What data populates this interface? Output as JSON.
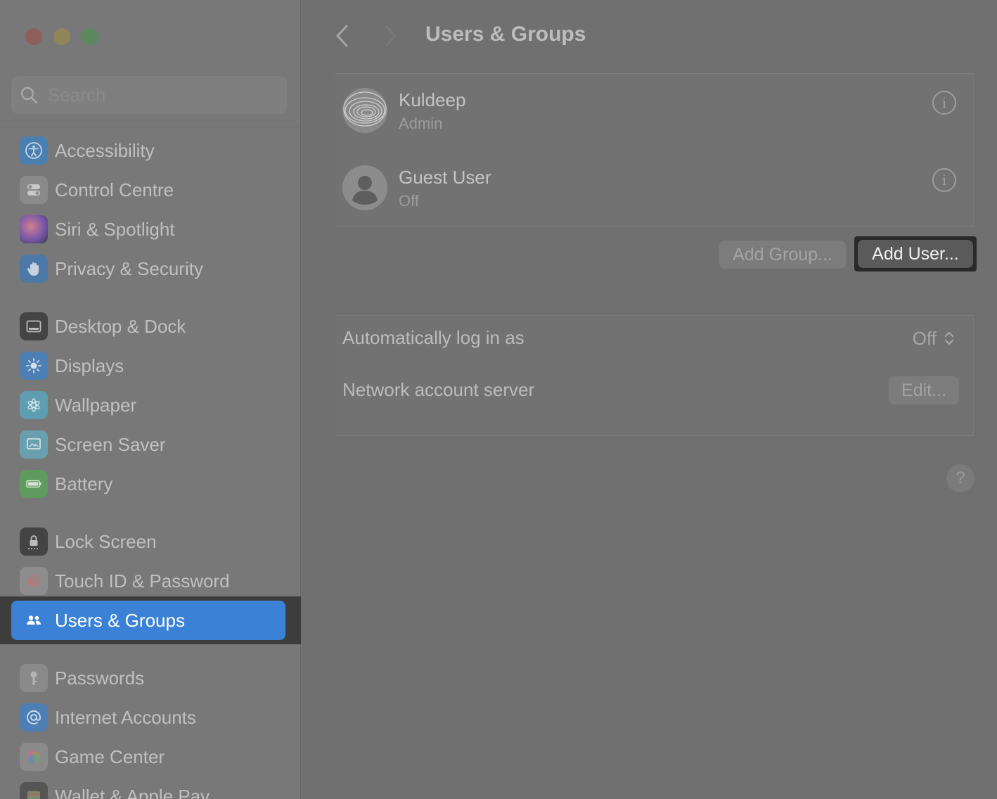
{
  "window": {
    "title": "Users & Groups"
  },
  "search": {
    "placeholder": "Search"
  },
  "sidebar": {
    "items": [
      {
        "label": "Accessibility",
        "icon": "accessibility-icon",
        "color": "#4b7fb0"
      },
      {
        "label": "Control Centre",
        "icon": "control-centre-icon",
        "color": "#8a8a8a"
      },
      {
        "label": "Siri & Spotlight",
        "icon": "siri-icon",
        "color": "#8a6aa8"
      },
      {
        "label": "Privacy & Security",
        "icon": "hand-icon",
        "color": "#4d78a8"
      },
      {
        "label": "Desktop & Dock",
        "icon": "dock-icon",
        "color": "#444444"
      },
      {
        "label": "Displays",
        "icon": "sun-icon",
        "color": "#4d7fb4"
      },
      {
        "label": "Wallpaper",
        "icon": "wallpaper-icon",
        "color": "#5f9db0"
      },
      {
        "label": "Screen Saver",
        "icon": "screen-saver-icon",
        "color": "#6aa0ae"
      },
      {
        "label": "Battery",
        "icon": "battery-icon",
        "color": "#5f9a5f"
      },
      {
        "label": "Lock Screen",
        "icon": "lock-icon",
        "color": "#444444"
      },
      {
        "label": "Touch ID & Password",
        "icon": "fingerprint-icon",
        "color": "#8d8d8d"
      },
      {
        "label": "Users & Groups",
        "icon": "users-icon",
        "color": "#3b82d6",
        "selected": true
      },
      {
        "label": "Passwords",
        "icon": "key-icon",
        "color": "#8a8a8a"
      },
      {
        "label": "Internet Accounts",
        "icon": "at-icon",
        "color": "#4d7fb4"
      },
      {
        "label": "Game Center",
        "icon": "game-center-icon",
        "color": "#8a8a8a"
      },
      {
        "label": "Wallet & Apple Pay",
        "icon": "wallet-icon",
        "color": "#555555"
      }
    ]
  },
  "users": [
    {
      "name": "Kuldeep",
      "role": "Admin",
      "avatar": "fingerprint-avatar"
    },
    {
      "name": "Guest User",
      "role": "Off",
      "avatar": "person-avatar"
    }
  ],
  "actions": {
    "add_group": "Add Group...",
    "add_user": "Add User..."
  },
  "settings": {
    "auto_login_label": "Automatically log in as",
    "auto_login_value": "Off",
    "network_label": "Network account server",
    "edit_label": "Edit..."
  },
  "help": {
    "label": "?"
  },
  "colors": {
    "accent": "#3b82d6",
    "sidebar_bg": "#787879",
    "main_bg": "#707070"
  }
}
